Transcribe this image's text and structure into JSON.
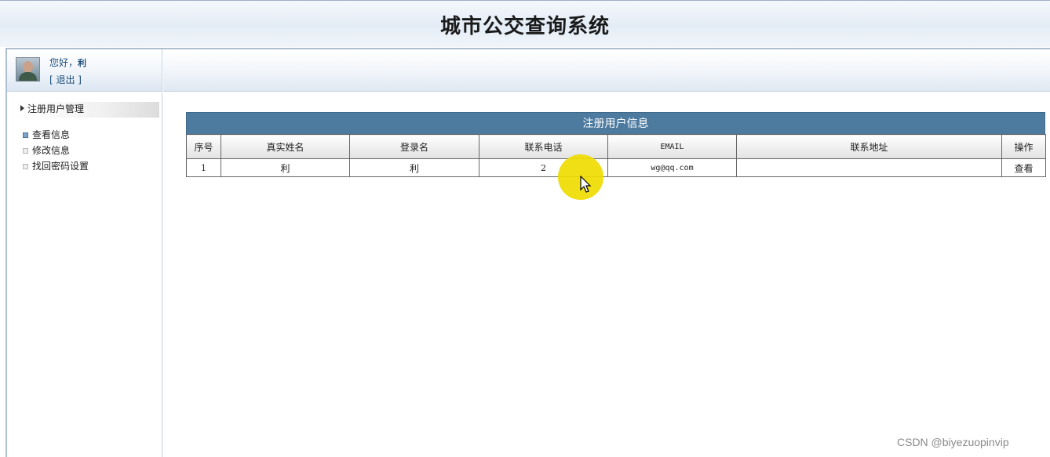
{
  "header": {
    "title": "城市公交查询系统"
  },
  "user": {
    "greeting": "您好，",
    "name": "利",
    "logout_label": "[ 退出 ]"
  },
  "sidebar": {
    "group_label": "注册用户管理",
    "items": [
      {
        "label": "查看信息",
        "active": true
      },
      {
        "label": "修改信息",
        "active": false
      },
      {
        "label": "找回密码设置",
        "active": false
      }
    ]
  },
  "main": {
    "panel_title": "注册用户信息",
    "columns": [
      "序号",
      "真实姓名",
      "登录名",
      "联系电话",
      "EMAIL",
      "联系地址",
      "操作"
    ],
    "rows": [
      {
        "index": "1",
        "real_name": "利",
        "login_name": "利",
        "phone": "2",
        "email": "wg@qq.com",
        "address": "",
        "action": "查看"
      }
    ]
  },
  "watermark": "CSDN @biyezuopinvip"
}
